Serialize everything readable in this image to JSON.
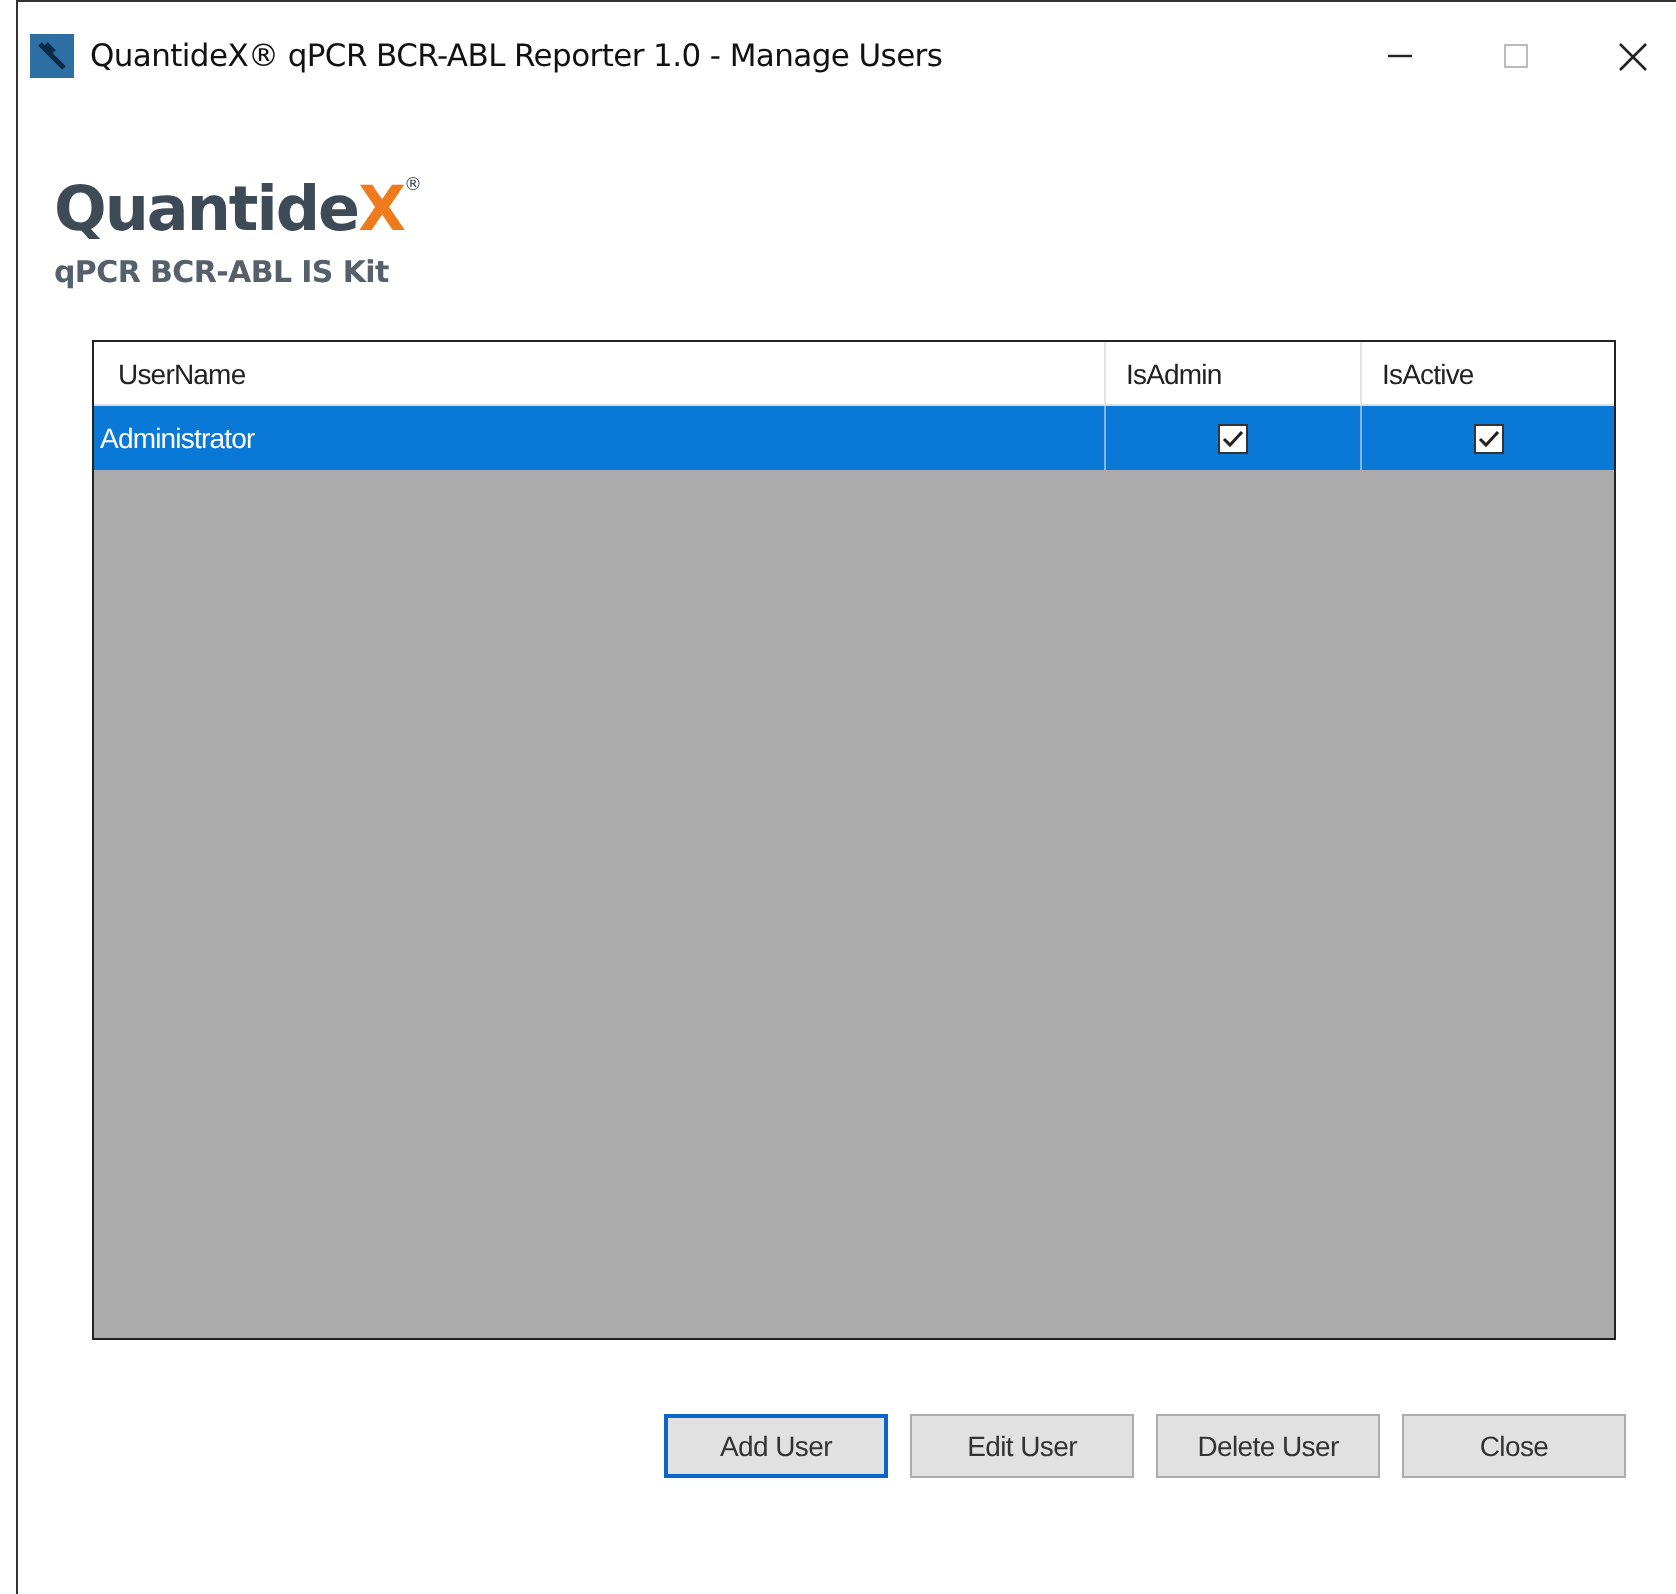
{
  "window": {
    "title": "QuantideX® qPCR BCR-ABL Reporter 1.0 - Manage Users"
  },
  "logo": {
    "wordmark": "Quantide",
    "accent": "X",
    "mark": "®",
    "subtitle": "qPCR BCR-ABL IS Kit"
  },
  "table": {
    "columns": [
      "UserName",
      "IsAdmin",
      "IsActive"
    ],
    "rows": [
      {
        "username": "Administrator",
        "is_admin": true,
        "is_active": true,
        "selected": true
      }
    ]
  },
  "buttons": [
    {
      "label": "Add User",
      "focused": true
    },
    {
      "label": "Edit User",
      "focused": false
    },
    {
      "label": "Delete User",
      "focused": false
    },
    {
      "label": "Close",
      "focused": false
    }
  ]
}
